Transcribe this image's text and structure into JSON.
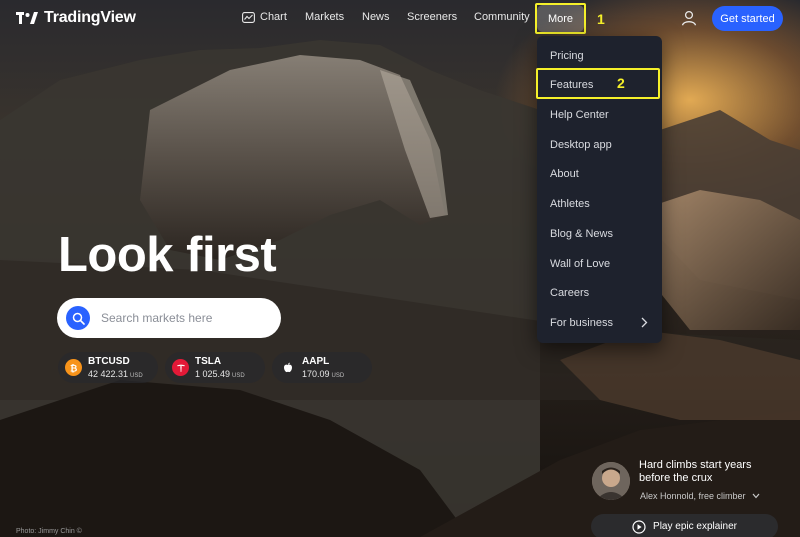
{
  "brand": {
    "name": "TradingView",
    "icon": "tradingview-logo-icon"
  },
  "nav": {
    "items": [
      {
        "label": "Chart",
        "icon": "chart-icon"
      },
      {
        "label": "Markets"
      },
      {
        "label": "News"
      },
      {
        "label": "Screeners"
      },
      {
        "label": "Community"
      }
    ],
    "more_label": "More",
    "cta_label": "Get started",
    "user_icon": "user-icon"
  },
  "annotations": {
    "callout_1": "1",
    "callout_2": "2",
    "highlight_color": "#f5f02a"
  },
  "dropdown": {
    "items": [
      {
        "label": "Pricing"
      },
      {
        "label": "Features"
      },
      {
        "label": "Help Center"
      },
      {
        "label": "Desktop app"
      },
      {
        "label": "About"
      },
      {
        "label": "Athletes"
      },
      {
        "label": "Blog & News"
      },
      {
        "label": "Wall of Love"
      },
      {
        "label": "Careers"
      },
      {
        "label": "For business",
        "icon": "chevron-right-icon"
      }
    ]
  },
  "hero": {
    "title": "Look first",
    "search_placeholder": "Search markets here"
  },
  "tickers": [
    {
      "symbol": "BTCUSD",
      "price": "42 422.31",
      "currency": "USD",
      "icon": "bitcoin-icon",
      "color": "#f7931a"
    },
    {
      "symbol": "TSLA",
      "price": "1 025.49",
      "currency": "USD",
      "icon": "tesla-icon",
      "color": "#e31937"
    },
    {
      "symbol": "AAPL",
      "price": "170.09",
      "currency": "USD",
      "icon": "apple-icon",
      "color": "#ffffff"
    }
  ],
  "feature_card": {
    "quote": "Hard climbs start years before the crux",
    "author": "Alex Honnold, free climber",
    "play_label": "Play epic explainer"
  },
  "photo_credit": "Photo: Jimmy Chin ©",
  "colors": {
    "accent": "#2962ff",
    "menu_bg": "#1e222d"
  }
}
